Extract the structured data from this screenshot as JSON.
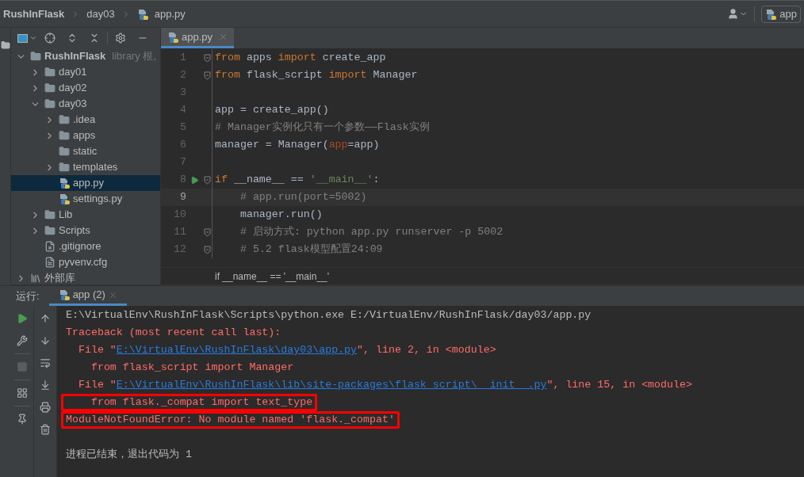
{
  "breadcrumb": [
    "RushInFlask",
    "day03",
    "app.py"
  ],
  "run_config": {
    "label": "app"
  },
  "project_tree": [
    {
      "label": "RushInFlask",
      "suffix": "library 根,",
      "kind": "root",
      "expanded": true,
      "selected": false,
      "children": [
        {
          "label": "day01",
          "kind": "folder",
          "expanded": false,
          "selected": false
        },
        {
          "label": "day02",
          "kind": "folder",
          "expanded": false,
          "selected": false
        },
        {
          "label": "day03",
          "kind": "folder",
          "expanded": true,
          "selected": false,
          "children": [
            {
              "label": ".idea",
              "kind": "folder",
              "expanded": false,
              "selected": false
            },
            {
              "label": "apps",
              "kind": "package",
              "expanded": false,
              "selected": false
            },
            {
              "label": "static",
              "kind": "folder",
              "selected": false
            },
            {
              "label": "templates",
              "kind": "folder",
              "expanded": false,
              "selected": false
            },
            {
              "label": "app.py",
              "kind": "python",
              "selected": true
            },
            {
              "label": "settings.py",
              "kind": "python",
              "selected": false
            }
          ]
        },
        {
          "label": "Lib",
          "kind": "folder",
          "expanded": false,
          "selected": false
        },
        {
          "label": "Scripts",
          "kind": "folder",
          "expanded": false,
          "selected": false
        },
        {
          "label": ".gitignore",
          "kind": "ignore",
          "selected": false
        },
        {
          "label": "pyvenv.cfg",
          "kind": "text",
          "selected": false
        }
      ]
    },
    {
      "label": "外部库",
      "kind": "library",
      "expanded": false,
      "selected": false
    }
  ],
  "editor_tabs": [
    {
      "label": "app.py",
      "selected": true
    }
  ],
  "code_lines": [
    {
      "number": "1",
      "fold": true,
      "run": false,
      "current": false,
      "tokens": [
        {
          "t": "from ",
          "kind": "kw"
        },
        {
          "t": "apps ",
          "kind": "plain"
        },
        {
          "t": "import ",
          "kind": "kw"
        },
        {
          "t": "create_app",
          "kind": "plain"
        }
      ]
    },
    {
      "number": "2",
      "fold": true,
      "run": false,
      "current": false,
      "tokens": [
        {
          "t": "from ",
          "kind": "kw"
        },
        {
          "t": "flask_script ",
          "kind": "plain"
        },
        {
          "t": "import ",
          "kind": "kw"
        },
        {
          "t": "Manager",
          "kind": "plain"
        }
      ]
    },
    {
      "number": "3",
      "fold": false,
      "run": false,
      "current": false
    },
    {
      "number": "4",
      "fold": false,
      "run": false,
      "current": false,
      "tokens": [
        {
          "t": "app = create_app()",
          "kind": "plain"
        }
      ]
    },
    {
      "number": "5",
      "fold": false,
      "run": false,
      "current": false,
      "tokens": [
        {
          "t": "# Manager实例化只有一个参数——Flask实例",
          "kind": "comment"
        }
      ]
    },
    {
      "number": "6",
      "fold": false,
      "run": false,
      "current": false,
      "tokens": [
        {
          "t": "manager = Manager(",
          "kind": "plain"
        },
        {
          "t": "app",
          "kind": "param"
        },
        {
          "t": "=app)",
          "kind": "plain"
        }
      ]
    },
    {
      "number": "7",
      "fold": false,
      "run": false,
      "current": false
    },
    {
      "number": "8",
      "fold": true,
      "run": true,
      "current": false,
      "tokens": [
        {
          "t": "if ",
          "kind": "kw"
        },
        {
          "t": "__name__ == ",
          "kind": "plain"
        },
        {
          "t": "'__main__'",
          "kind": "string"
        },
        {
          "t": ":",
          "kind": "plain"
        }
      ]
    },
    {
      "number": "9",
      "fold": false,
      "run": false,
      "current": true,
      "tokens": [
        {
          "t": "    # app.run(port=5002)",
          "kind": "comment"
        }
      ]
    },
    {
      "number": "10",
      "fold": false,
      "run": false,
      "current": false,
      "tokens": [
        {
          "t": "    manager.run()",
          "kind": "plain"
        }
      ]
    },
    {
      "number": "11",
      "fold": true,
      "run": false,
      "current": false,
      "tokens": [
        {
          "t": "    # 启动方式: python app.py runserver -p 5002",
          "kind": "comment"
        }
      ]
    },
    {
      "number": "12",
      "fold": true,
      "run": false,
      "current": false,
      "tokens": [
        {
          "t": "    # 5.2 flask模型配置24:09",
          "kind": "comment"
        }
      ]
    }
  ],
  "editor_breadcrumb": "if __name__ == '__main__'",
  "run_panel": {
    "label": "运行:",
    "tabs": [
      {
        "label": "app (2)",
        "selected": true
      }
    ]
  },
  "console_lines": [
    {
      "boxed": false,
      "tokens": [
        {
          "t": "E:\\VirtualEnv\\RushInFlask\\Scripts\\python.exe E:/VirtualEnv/RushInFlask/day03/app.py",
          "kind": "plain"
        }
      ]
    },
    {
      "boxed": false,
      "tokens": [
        {
          "t": "Traceback (most recent call last):",
          "kind": "error"
        }
      ]
    },
    {
      "boxed": false,
      "tokens": [
        {
          "t": "  File \"",
          "kind": "error"
        },
        {
          "t": "E:\\VirtualEnv\\RushInFlask\\day03\\app.py",
          "kind": "link"
        },
        {
          "t": "\", line 2, in <module>",
          "kind": "error"
        }
      ]
    },
    {
      "boxed": false,
      "tokens": [
        {
          "t": "    from flask_script import Manager",
          "kind": "error"
        }
      ]
    },
    {
      "boxed": false,
      "tokens": [
        {
          "t": "  File \"",
          "kind": "error"
        },
        {
          "t": "E:\\VirtualEnv\\RushInFlask\\lib\\site-packages\\flask_script\\__init__.py",
          "kind": "link"
        },
        {
          "t": "\", line 15, in <module>",
          "kind": "error"
        }
      ]
    },
    {
      "boxed": true,
      "tokens": [
        {
          "t": "    from flask._compat import text_type",
          "kind": "error"
        }
      ]
    },
    {
      "boxed": true,
      "tokens": [
        {
          "t": "ModuleNotFoundError: No module named 'flask._compat'",
          "kind": "error"
        }
      ]
    },
    {
      "boxed": false
    },
    {
      "boxed": false,
      "tokens": [
        {
          "t": "进程已结束，退出代码为 1",
          "kind": "plain"
        }
      ]
    }
  ]
}
